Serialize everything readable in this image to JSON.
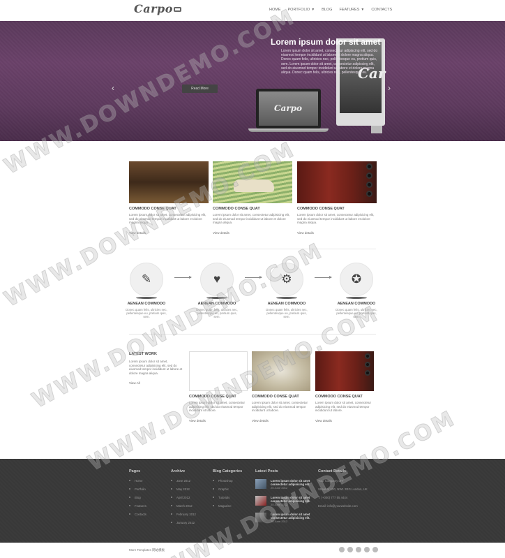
{
  "header": {
    "logo": "Carpo",
    "nav": [
      {
        "label": "HOME",
        "caret": false
      },
      {
        "label": "PORTFOLIO",
        "caret": true
      },
      {
        "label": "BLOG",
        "caret": false
      },
      {
        "label": "FEATURES",
        "caret": true
      },
      {
        "label": "CONTACTS",
        "caret": false
      }
    ]
  },
  "hero": {
    "title": "Lorem ipsum dolor sit amet",
    "text": "Lorem ipsum dolor sit amet, consectetur adipiscing elit, sed do eiusmod tempor incididunt ut labore et dolore magna aliqua. Donec quam felis, ultricies nec, pellentesque eu, pretium quis, sem. Lorem ipsum dolor sit amet, consectetur adipiscing elit, sed do eiusmod tempor incididunt ut labore et dolore magna aliqua. Donec quam felis, ultricies nec, pellentesque eu.",
    "button": "Read More",
    "laptop_logo": "Carpo",
    "monitor_logo": "Car",
    "prev_arrow": "‹",
    "next_arrow": "›"
  },
  "featured": [
    {
      "title": "COMMODO CONSE QUAT",
      "text": "Lorem ipsum dolor sit amet, consectetur adipisicing elit, sed do eiusmod tempor incididunt ut labore et dolore magna aliqua.",
      "link": "View details"
    },
    {
      "title": "COMMODO CONSE QUAT",
      "text": "Lorem ipsum dolor sit amet, consectetur adipisicing elit, sed do eiusmod tempor incididunt ut labore et dolore magna aliqua.",
      "link": "View details"
    },
    {
      "title": "COMMODO CONSE QUAT",
      "text": "Lorem ipsum dolor sit amet, consectetur adipisicing elit, sed do eiusmod tempor incididunt ut labore et dolore magna aliqua.",
      "link": "View details"
    }
  ],
  "services": [
    {
      "icon": "✎",
      "icon_name": "brush-icon",
      "title": "AENEAN COMMODO",
      "text": "Donec quam felis, ultricies nec, pellentesque eu, pretium quis, sem."
    },
    {
      "icon": "♥",
      "icon_name": "heart-icon",
      "title": "AENEAN COMMODO",
      "text": "Donec quam felis, ultricies nec, pellentesque eu, pretium quis, sem."
    },
    {
      "icon": "⚙",
      "icon_name": "gears-icon",
      "title": "AENEAN COMMODO",
      "text": "Donec quam felis, ultricies nec, pellentesque eu, pretium quis, sem."
    },
    {
      "icon": "✪",
      "icon_name": "award-icon",
      "title": "AENEAN COMMODO",
      "text": "Donec quam felis, ultricies nec, pellentesque eu, pretium quis, sem."
    }
  ],
  "latest_work": {
    "title": "LATEST WORK",
    "text": "Lorem ipsum dolor sit amet, consectetur adipisicing elit, sed do eiusmod tempor incididunt ut labore et dolore magna aliqua.",
    "link": "View All",
    "items": [
      {
        "title": "COMMODO CONSE QUAT",
        "text": "Lorem ipsum dolor sit amet, consectetur adipisicing elit, sed do eiusmod tempor incididunt ut labore.",
        "link": "View details"
      },
      {
        "title": "COMMODO CONSE QUAT",
        "text": "Lorem ipsum dolor sit amet, consectetur adipisicing elit, sed do eiusmod tempor incididunt ut labore.",
        "link": "View details"
      },
      {
        "title": "COMMODO CONSE QUAT",
        "text": "Lorem ipsum dolor sit amet, consectetur adipisicing elit, sed do eiusmod tempor incididunt ut labore.",
        "link": "View details"
      }
    ]
  },
  "footer": {
    "pages": {
      "title": "Pages",
      "items": [
        "Home",
        "Portfolio",
        "Blog",
        "Features",
        "Contacts"
      ]
    },
    "archive": {
      "title": "Archive",
      "items": [
        "June 2012",
        "May 2012",
        "April 2012",
        "March 2012",
        "February 2012",
        "January 2012"
      ]
    },
    "categories": {
      "title": "Blog Categories",
      "items": [
        "Photoshop",
        "Graphic",
        "Tutorials",
        "Magazine"
      ]
    },
    "latest_posts": {
      "title": "Latest Posts",
      "items": [
        {
          "text": "Lorem ipsum dolor sit amet consectetur adipisicing elit.",
          "date": "25 June 2012"
        },
        {
          "text": "Lorem ipsum dolor sit amet consectetur adipisicing elit.",
          "date": "25 June 2012"
        },
        {
          "text": "Lorem ipsum dolor sit amet consectetur adipisicing elit.",
          "date": "25 June 2012"
        }
      ]
    },
    "contact": {
      "title": "Contact Details",
      "items": [
        "Your Company LTT",
        "Street nr 100, NW1 2RG London, UK",
        "T: (+000) 777 55 4444",
        "Email: info@yourwebsite.com"
      ]
    }
  },
  "bottom": {
    "text": "More Templates 网站模板"
  },
  "watermark": "WWW.DOWNDEMO.COM",
  "colors": {
    "hero_purple": "#5e3a5e",
    "footer_dark": "#383838"
  }
}
